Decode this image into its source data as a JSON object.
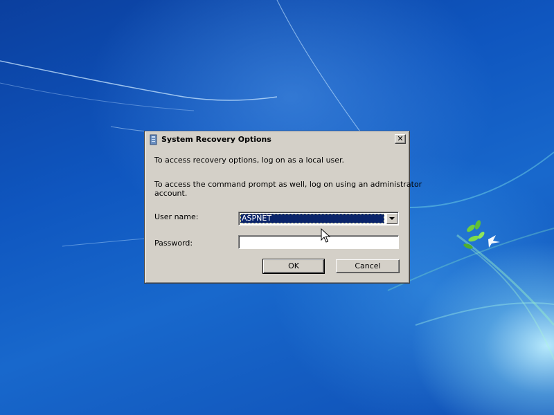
{
  "dialog": {
    "title": "System Recovery Options",
    "close_glyph": "✕",
    "intro_text": "To access recovery options, log on as a local user.",
    "admin_text_line1": "To access the command prompt as well, log on using an administrator",
    "admin_text_line2": "account.",
    "username_label": "User name:",
    "username_value": "ASPNET",
    "password_label": "Password:",
    "password_value": "",
    "ok_label": "OK",
    "cancel_label": "Cancel"
  },
  "icons": {
    "title": "recovery-icon",
    "close": "close-icon",
    "dropdown": "chevron-down-icon",
    "cursor": "mouse-pointer-icon"
  },
  "colors": {
    "dialog_bg": "#d4d0c8",
    "selection": "#0a246a",
    "desktop": "#0f56bf"
  }
}
